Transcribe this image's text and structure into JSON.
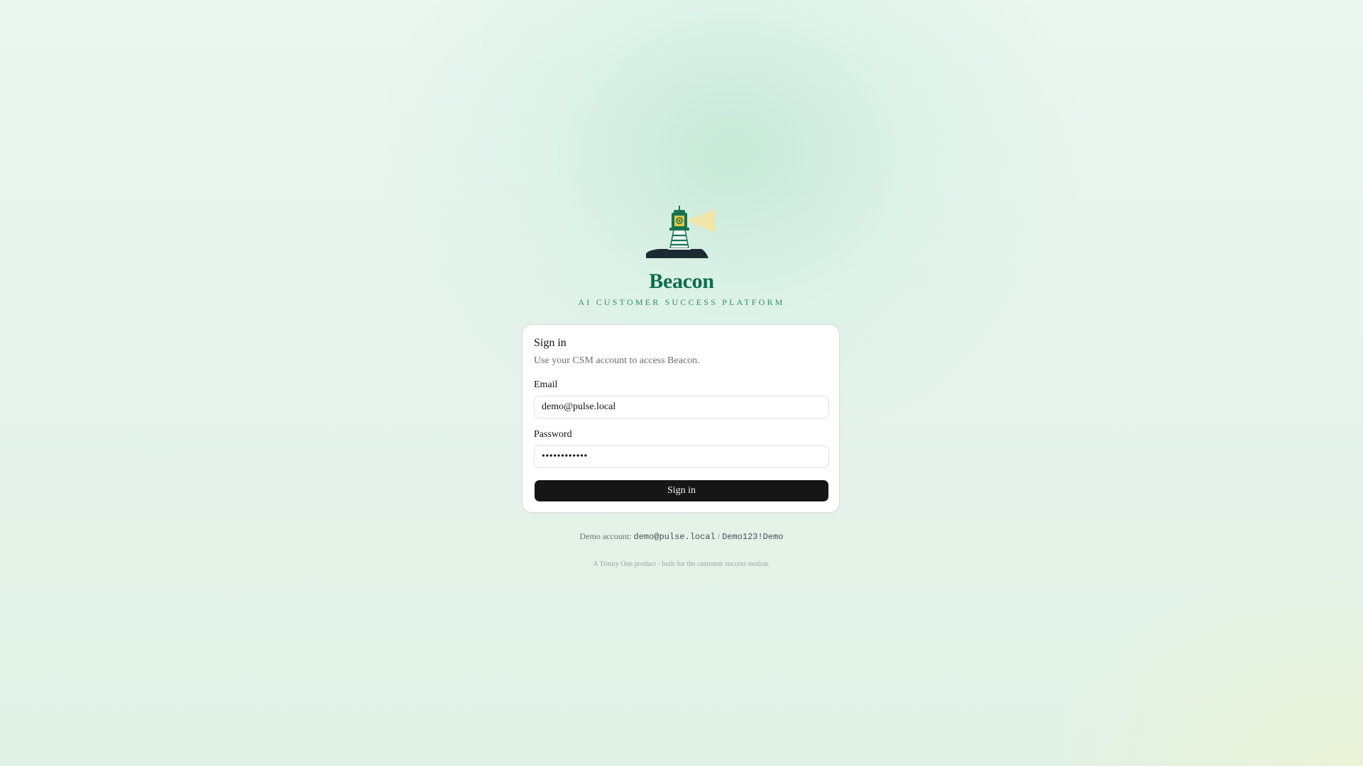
{
  "brand": {
    "title": "Beacon",
    "subtitle": "AI CUSTOMER SUCCESS PLATFORM",
    "logo_icon": "lighthouse-icon",
    "accent_color": "#0b6f4c",
    "subtitle_color": "#2f8f6b"
  },
  "signin_card": {
    "title": "Sign in",
    "description": "Use your CSM account to access Beacon.",
    "email_label": "Email",
    "email_value": "demo@pulse.local",
    "password_label": "Password",
    "password_value": "Demo123!Demo",
    "button_label": "Sign in",
    "button_color": "#161616"
  },
  "demo_account": {
    "prefix": "Demo account:",
    "email": "demo@pulse.local",
    "separator": "/",
    "password": "Demo123!Demo"
  },
  "footer": {
    "text": "A Trinity One product · built for the customer success motion."
  }
}
